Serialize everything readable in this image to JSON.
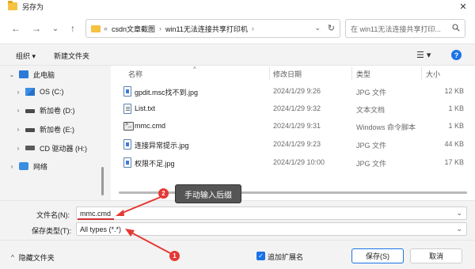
{
  "window": {
    "title": "另存为",
    "close_glyph": "✕"
  },
  "navigation": {
    "back": "←",
    "forward": "→",
    "dropdown": "⌄",
    "up": "↑",
    "path": [
      "«",
      "csdn文章截图",
      "›",
      "win11无法连接共享打印机",
      "›"
    ],
    "refresh": "↻",
    "search_placeholder": "在 win11无法连接共享打印..."
  },
  "toolbar": {
    "organize": "组织 ▾",
    "new_folder": "新建文件夹",
    "view": "☰ ▾",
    "help": "?"
  },
  "tree": [
    {
      "chev": "⌄",
      "label": "此电脑",
      "icon": "computer-icon"
    },
    {
      "chev": "›",
      "label": "OS (C:)",
      "icon": "windows-drive-icon"
    },
    {
      "chev": "›",
      "label": "新加卷 (D:)",
      "icon": "drive-icon"
    },
    {
      "chev": "›",
      "label": "新加卷 (E:)",
      "icon": "drive-icon"
    },
    {
      "chev": "›",
      "label": "CD 驱动器 (H:)",
      "icon": "cd-drive-icon"
    },
    {
      "chev": "›",
      "label": "网络",
      "icon": "network-icon"
    }
  ],
  "columns": {
    "name": "名称",
    "sort_caret": "^",
    "date": "修改日期",
    "type": "类型",
    "size": "大小"
  },
  "files": [
    {
      "name": "gpdit.msc找不到.jpg",
      "date": "2024/1/29 9:26",
      "type": "JPG 文件",
      "size": "12 KB",
      "icon": "image-file-icon"
    },
    {
      "name": "List.txt",
      "date": "2024/1/29 9:32",
      "type": "文本文档",
      "size": "1 KB",
      "icon": "text-file-icon"
    },
    {
      "name": "mmc.cmd",
      "date": "2024/1/29 9:31",
      "type": "Windows 命令脚本",
      "size": "1 KB",
      "icon": "cmd-file-icon"
    },
    {
      "name": "连接异常提示.jpg",
      "date": "2024/1/29 9:23",
      "type": "JPG 文件",
      "size": "44 KB",
      "icon": "image-file-icon"
    },
    {
      "name": "权限不足.jpg",
      "date": "2024/1/29 10:00",
      "type": "JPG 文件",
      "size": "17 KB",
      "icon": "image-file-icon"
    }
  ],
  "form": {
    "filename_label": "文件名(N):",
    "filename_value": "mmc.cmd",
    "filetype_label": "保存类型(T):",
    "filetype_value": "All types (*.*)",
    "dropdown_glyph": "⌄"
  },
  "footer": {
    "hide_folders": "隐藏文件夹",
    "hide_caret": "^",
    "add_extension_label": "追加扩展名",
    "add_extension_checked": true,
    "check_glyph": "✓",
    "save": "保存(S)",
    "cancel": "取消"
  },
  "annotations": {
    "badge1": "1",
    "badge2": "2",
    "callout": "手动输入后缀",
    "color": "#e53935"
  }
}
